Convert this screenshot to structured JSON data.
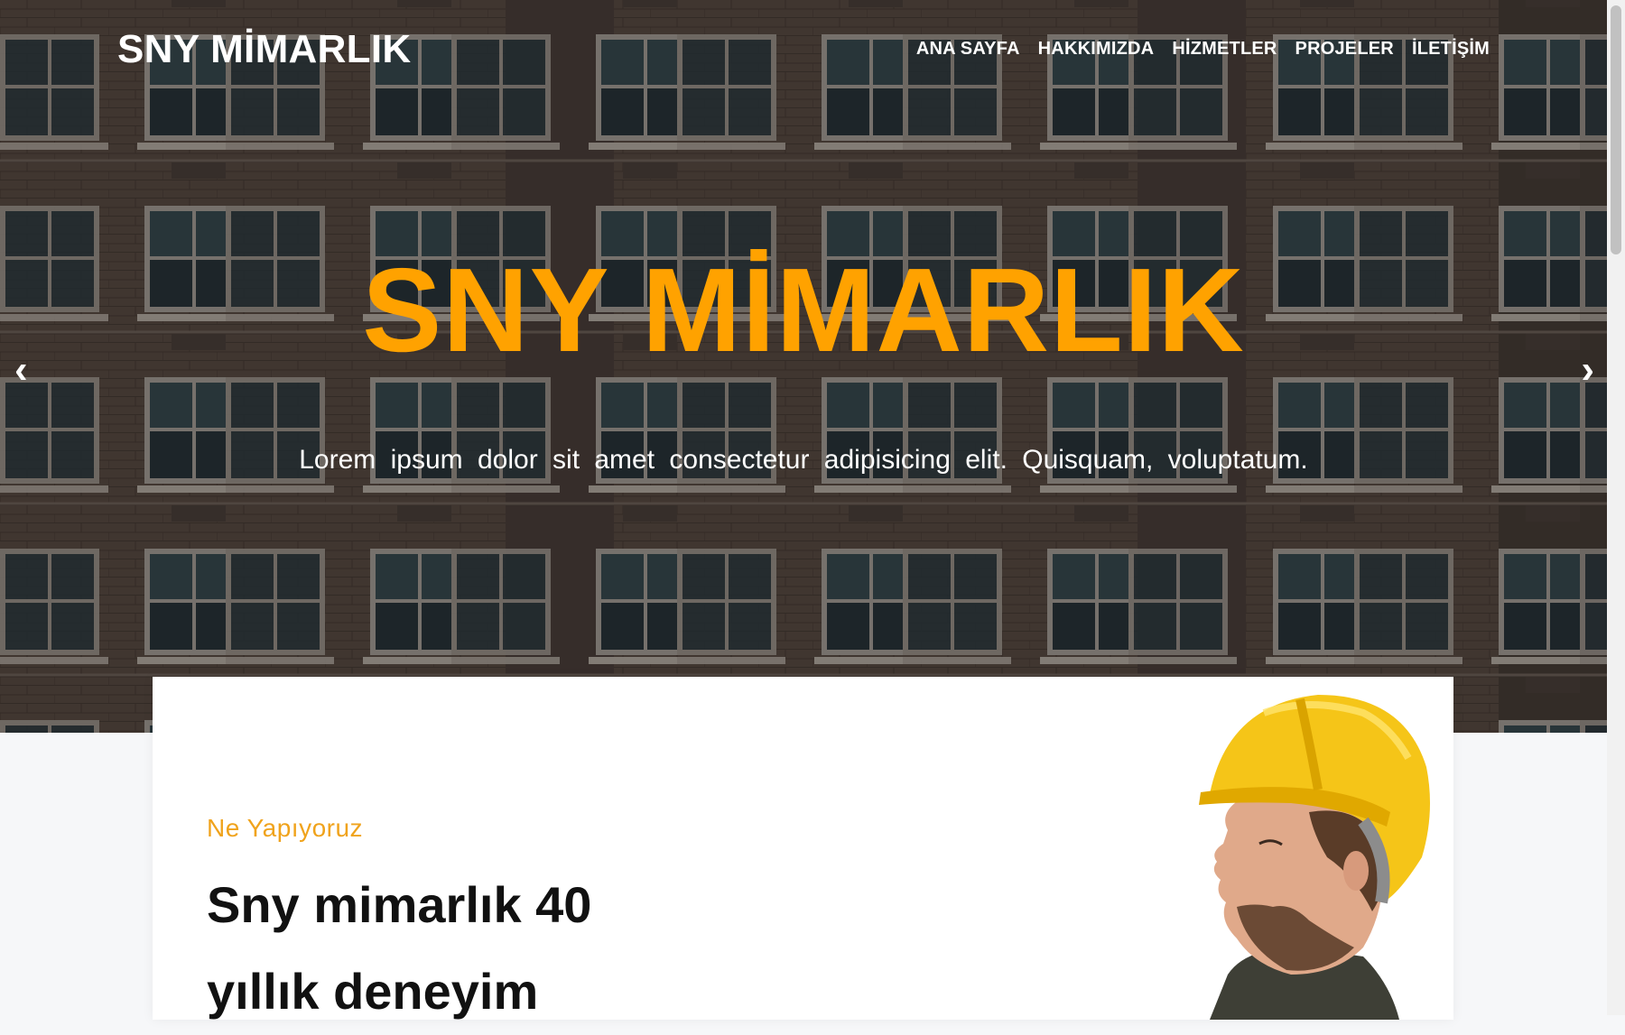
{
  "header": {
    "brand": "SNY MİMARLIK",
    "nav": [
      "ANA SAYFA",
      "HAKKIMIZDA",
      "HİZMETLER",
      "PROJELER",
      "İLETİŞİM"
    ]
  },
  "hero": {
    "title": "SNY MİMARLIK",
    "subtitle": "Lorem ipsum dolor sit amet consectetur adipisicing elit. Quisquam, voluptatum.",
    "prev_arrow": "‹",
    "next_arrow": "›"
  },
  "about": {
    "eyebrow": "Ne Yapıyoruz",
    "heading": "Sny mimarlık 40 yıllık deneyim"
  },
  "colors": {
    "accent": "#ffa200",
    "hero_title": "#ffa200",
    "eyebrow": "#f0a31c",
    "helmet": "#f5c518"
  }
}
